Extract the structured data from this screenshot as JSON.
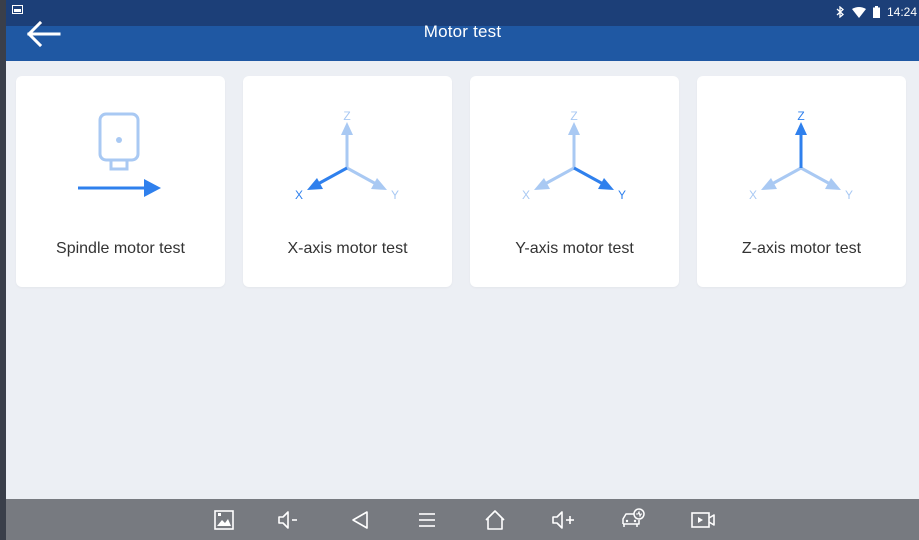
{
  "status_bar": {
    "time": "14:24",
    "icons": [
      "gallery-notification-icon",
      "bluetooth-icon",
      "wifi-icon",
      "battery-icon"
    ]
  },
  "app_bar": {
    "title": "Motor test",
    "back_icon": "arrow-left-icon",
    "background": "#1f58a3"
  },
  "cards": [
    {
      "label": "Spindle motor test",
      "icon": "spindle-motor-icon"
    },
    {
      "label": "X-axis motor test",
      "icon": "x-axis-icon"
    },
    {
      "label": "Y-axis motor test",
      "icon": "y-axis-icon"
    },
    {
      "label": "Z-axis motor test",
      "icon": "z-axis-icon"
    }
  ],
  "axis_letters": {
    "x": "X",
    "y": "Y",
    "z": "Z"
  },
  "colors": {
    "accent": "#2f80ed",
    "accent_light": "#a9c9f3",
    "page_background": "#eceff4",
    "nav_background": "#777a80"
  },
  "nav_bar": {
    "buttons": [
      "screenshot-icon",
      "volume-down-icon",
      "back-triangle-icon",
      "menu-icon",
      "home-icon",
      "volume-up-icon",
      "vehicle-diagnostic-icon",
      "screen-record-icon"
    ]
  }
}
